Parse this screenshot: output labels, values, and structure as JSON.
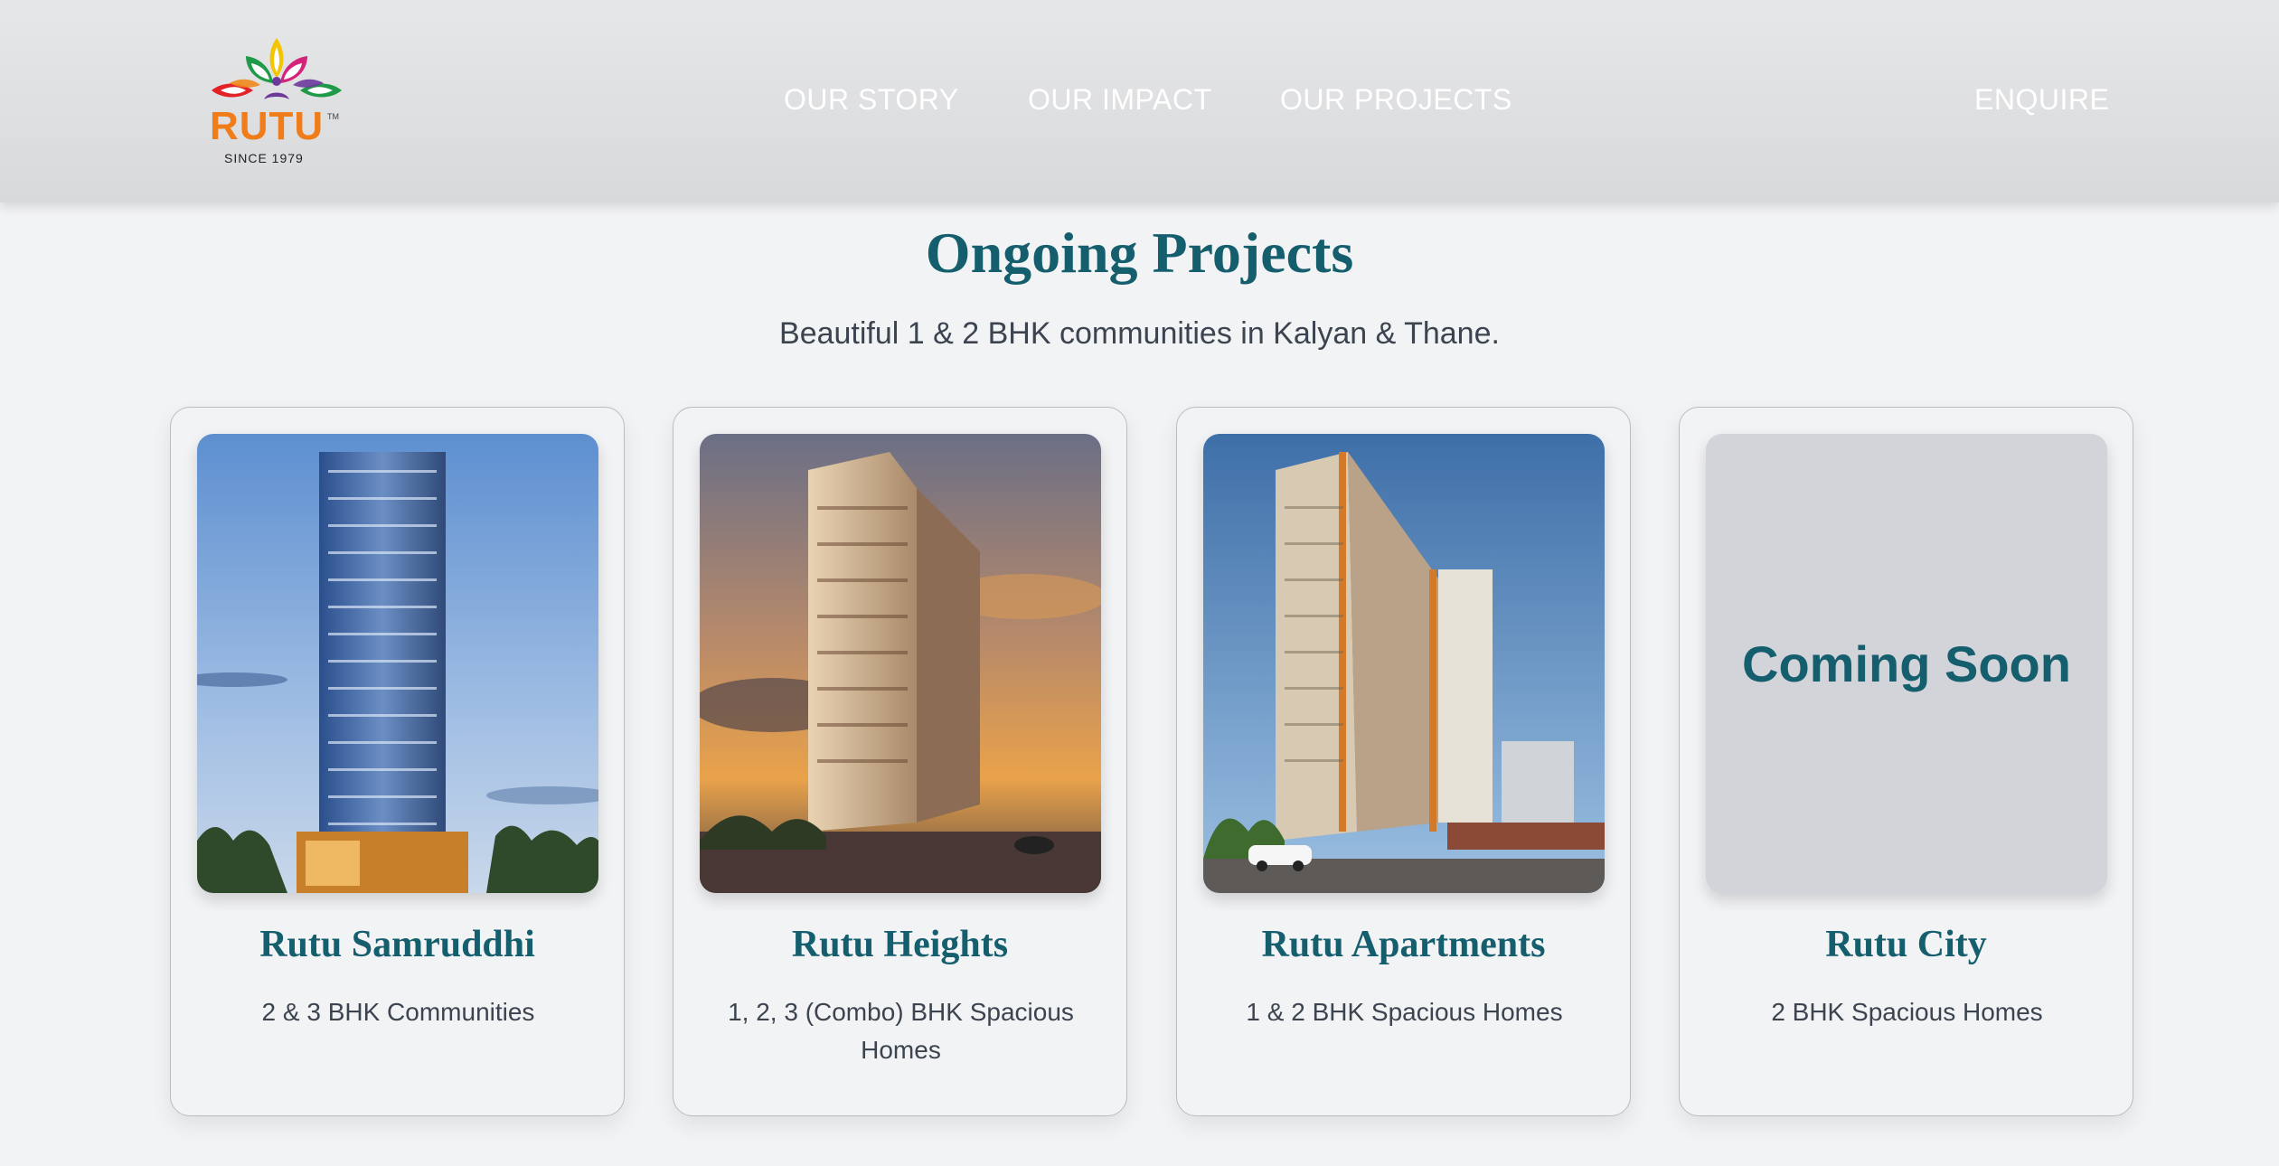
{
  "brand": {
    "logo_text": "RUTU",
    "logo_tagline": "SINCE 1979",
    "logo_mark": "TM"
  },
  "nav": {
    "story": "OUR STORY",
    "impact": "OUR IMPACT",
    "projects": "OUR PROJECTS",
    "enquire": "ENQUIRE"
  },
  "section": {
    "title": "Ongoing Projects",
    "subtitle": "Beautiful 1 & 2 BHK communities in Kalyan & Thane."
  },
  "projects": [
    {
      "name": "Rutu Samruddhi",
      "description": "2 & 3 BHK Communities",
      "image": "tall-tower-photo"
    },
    {
      "name": "Rutu Heights",
      "description": "1, 2, 3 (Combo) BHK Spacious Homes",
      "image": "sunset-tower-photo"
    },
    {
      "name": "Rutu Apartments",
      "description": "1 & 2 BHK Spacious Homes",
      "image": "apartment-building-photo"
    },
    {
      "name": "Rutu City",
      "description": "2 BHK Spacious Homes",
      "placeholder_text": "Coming Soon"
    }
  ],
  "colors": {
    "accent": "#155e6e",
    "header_bg": "#e0e1e3",
    "page_bg": "#f2f3f5",
    "body_text": "#3c4450"
  }
}
